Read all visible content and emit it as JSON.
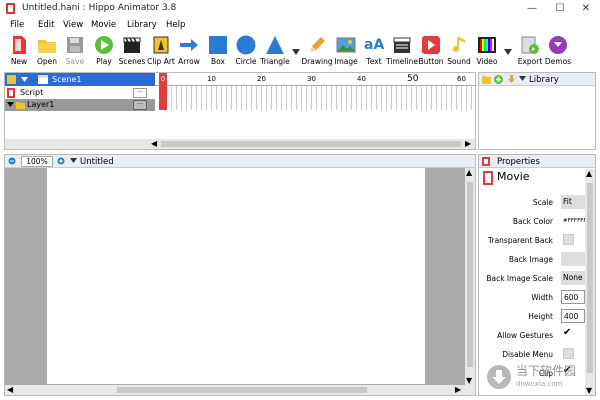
{
  "window": {
    "title": "Untitled.hani : Hippo Animator 3.8",
    "minimize": "—",
    "maximize": "☐",
    "close": "✕"
  },
  "menu": [
    "File",
    "Edit",
    "View",
    "Movie",
    "Library",
    "Help"
  ],
  "toolbar": [
    {
      "label": "New",
      "icon": "new-document-icon"
    },
    {
      "label": "Open",
      "icon": "folder-icon"
    },
    {
      "label": "Save",
      "icon": "floppy-disk-icon",
      "disabled": true
    },
    {
      "label": "Play",
      "icon": "play-icon"
    },
    {
      "label": "Scenes",
      "icon": "clapperboard-icon"
    },
    {
      "label": "Clip Art",
      "icon": "clip-art-icon"
    },
    {
      "label": "Arrow",
      "icon": "arrow-icon"
    },
    {
      "label": "Box",
      "icon": "square-icon"
    },
    {
      "label": "Circle",
      "icon": "circle-icon"
    },
    {
      "label": "Triangle",
      "icon": "triangle-icon"
    },
    {
      "label": "Drawing",
      "icon": "pencil-icon"
    },
    {
      "label": "Image",
      "icon": "picture-icon"
    },
    {
      "label": "Text",
      "icon": "text-icon",
      "glyph": "aA"
    },
    {
      "label": "Timeline",
      "icon": "timeline-icon"
    },
    {
      "label": "Button",
      "icon": "button-icon"
    },
    {
      "label": "Sound",
      "icon": "music-note-icon"
    },
    {
      "label": "Video",
      "icon": "video-icon"
    },
    {
      "label": "Export",
      "icon": "export-icon"
    },
    {
      "label": "Demos",
      "icon": "demos-icon"
    }
  ],
  "timeline": {
    "scene": "Scene1",
    "script": "Script",
    "layer": "Layer1",
    "more": "···",
    "ruler": [
      "0",
      "10",
      "20",
      "30",
      "40",
      "50",
      "60"
    ],
    "current_frame": "0"
  },
  "library": {
    "title": "Library"
  },
  "canvas": {
    "zoom": "100%",
    "title": "Untitled"
  },
  "properties": {
    "title": "Properties",
    "object": "Movie",
    "rows": [
      {
        "label": "Scale",
        "value": "Fit",
        "type": "select"
      },
      {
        "label": "Back Color",
        "value": "#FFFFFF",
        "type": "color"
      },
      {
        "label": "Transparent Back",
        "value": "",
        "type": "check",
        "checked": false
      },
      {
        "label": "Back Image",
        "value": "",
        "type": "field"
      },
      {
        "label": "Back Image Scale",
        "value": "None",
        "type": "select"
      },
      {
        "label": "Width",
        "value": "600",
        "type": "input"
      },
      {
        "label": "Height",
        "value": "400",
        "type": "input"
      },
      {
        "label": "Allow Gestures",
        "value": "",
        "type": "check",
        "checked": true
      },
      {
        "label": "Disable Menu",
        "value": "",
        "type": "check",
        "checked": false
      },
      {
        "label": "Clip",
        "value": "",
        "type": "check",
        "checked": true
      }
    ]
  },
  "watermark": {
    "text": "当下软件园",
    "sub": "downxia.com"
  },
  "colors": {
    "accent": "#2b6cd4",
    "playhead": "#e03c3c",
    "canvas_bg": "#ababab"
  }
}
